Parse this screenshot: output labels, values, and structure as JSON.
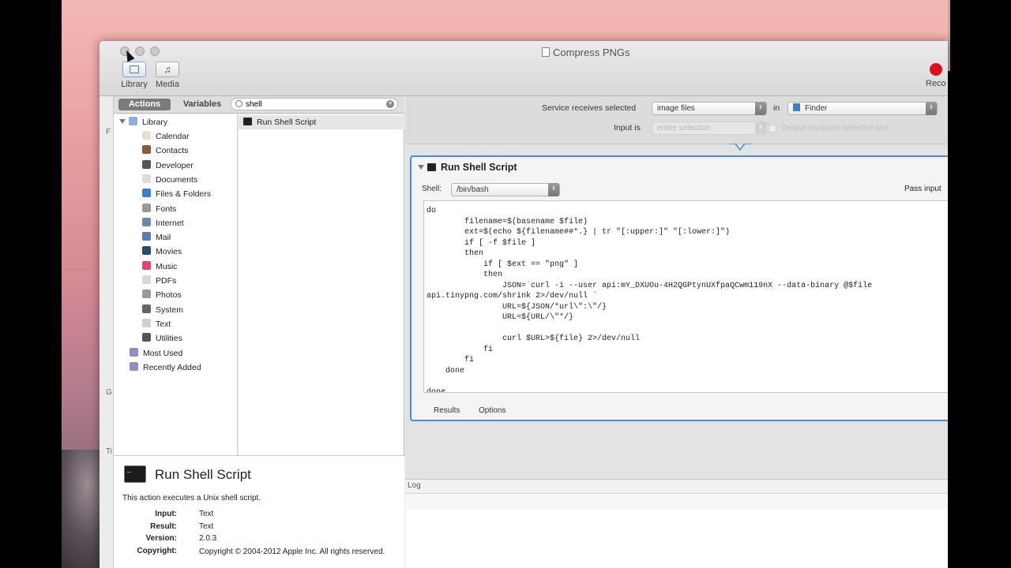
{
  "window": {
    "title": "Compress PNGs"
  },
  "toolbar": {
    "library_label": "Library",
    "media_label": "Media",
    "record_label": "Reco"
  },
  "library": {
    "tabs": {
      "actions": "Actions",
      "variables": "Variables"
    },
    "search": {
      "value": "shell"
    },
    "root": "Library",
    "items": [
      {
        "label": "Calendar",
        "icon": "calendar-icon",
        "color": "#e8e0d8"
      },
      {
        "label": "Contacts",
        "icon": "contacts-icon",
        "color": "#8a5a3a"
      },
      {
        "label": "Developer",
        "icon": "tools-icon",
        "color": "#555555"
      },
      {
        "label": "Documents",
        "icon": "document-icon",
        "color": "#dcdcdc"
      },
      {
        "label": "Files & Folders",
        "icon": "finder-icon",
        "color": "#3a7fd0"
      },
      {
        "label": "Fonts",
        "icon": "fonts-icon",
        "color": "#999999"
      },
      {
        "label": "Internet",
        "icon": "globe-icon",
        "color": "#6a8aa8"
      },
      {
        "label": "Mail",
        "icon": "mail-icon",
        "color": "#5a7ab0"
      },
      {
        "label": "Movies",
        "icon": "movies-icon",
        "color": "#2a4a6a"
      },
      {
        "label": "Music",
        "icon": "music-icon",
        "color": "#e04a6a"
      },
      {
        "label": "PDFs",
        "icon": "pdf-icon",
        "color": "#d8d8d8"
      },
      {
        "label": "Photos",
        "icon": "photos-icon",
        "color": "#9a9a9a"
      },
      {
        "label": "System",
        "icon": "system-icon",
        "color": "#666666"
      },
      {
        "label": "Text",
        "icon": "text-icon",
        "color": "#d0d0d0"
      },
      {
        "label": "Utilities",
        "icon": "utilities-icon",
        "color": "#555555"
      }
    ],
    "smart_groups": [
      {
        "label": "Most Used",
        "icon": "smart-folder-icon",
        "color": "#9a8ac0"
      },
      {
        "label": "Recently Added",
        "icon": "smart-folder-icon",
        "color": "#9a8ac0"
      }
    ]
  },
  "actions_list": {
    "items": [
      "Run Shell Script"
    ]
  },
  "description": {
    "title": "Run Shell Script",
    "text": "This action executes a Unix shell script.",
    "rows": [
      {
        "key": "Input:",
        "value": "Text"
      },
      {
        "key": "Result:",
        "value": "Text"
      },
      {
        "key": "Version:",
        "value": "2.0.3"
      },
      {
        "key": "Copyright:",
        "value": "Copyright © 2004-2012 Apple Inc.  All rights reserved."
      }
    ]
  },
  "service": {
    "receives_label": "Service receives selected",
    "receives_value": "image files",
    "in_label": "in",
    "in_value": "Finder",
    "input_is_label": "Input is",
    "input_is_value": "entire selection",
    "output_replaces_label": "Output replaces selected text"
  },
  "action_box": {
    "title": "Run Shell Script",
    "shell_label": "Shell:",
    "shell_value": "/bin/bash",
    "pass_input_label": "Pass input",
    "script": "do\n        filename=$(basename $file)\n        ext=$(echo ${filename##*.} | tr \"[:upper:]\" \"[:lower:]\")\n        if [ -f $file ]\n        then\n            if [ $ext == \"png\" ]\n            then\n                JSON=`curl -i --user api:mY_DXUOu-4H2QGPtynUXfpaQCwm119nX --data-binary @$file\napi.tinypng.com/shrink 2>/dev/null `\n                URL=${JSON/*url\\\":\\\"/}\n                URL=${URL/\\\"*/}\n\n                curl $URL>${file} 2>/dev/null\n            fi\n        fi\n    done\n\ndone",
    "tabs": [
      "Results",
      "Options"
    ]
  },
  "log": {
    "label": "Log"
  }
}
